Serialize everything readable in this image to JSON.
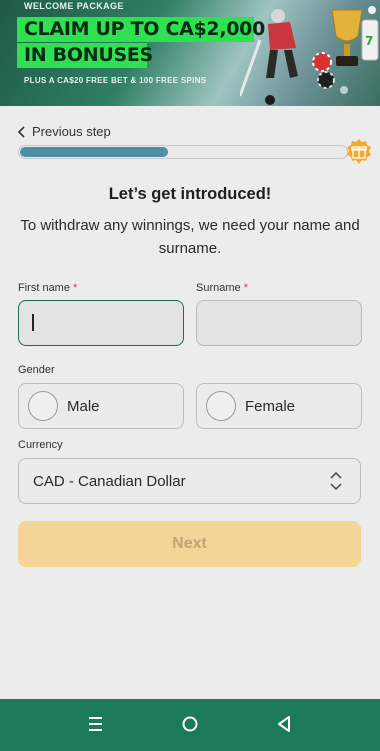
{
  "banner": {
    "kicker": "WELCOME PACKAGE",
    "headline_line1": "CLAIM UP TO CA$2,000",
    "headline_line2": "IN BONUSES",
    "subline": "PLUS A CA$20 FREE BET & 100 FREE SPINS",
    "accent_color": "#2fe050"
  },
  "progress": {
    "back_label": "Previous step",
    "fraction": 0.45,
    "reward_icon": "gift-icon"
  },
  "form": {
    "title": "Let’s get introduced!",
    "subtitle": "To withdraw any winnings, we need your name and surname.",
    "first_name": {
      "label": "First name",
      "required_mark": "*",
      "value": ""
    },
    "surname": {
      "label": "Surname",
      "required_mark": "*",
      "value": ""
    },
    "gender": {
      "label": "Gender",
      "options": [
        "Male",
        "Female"
      ],
      "selected": null
    },
    "currency": {
      "label": "Currency",
      "value": "CAD - Canadian Dollar"
    },
    "next_label": "Next"
  },
  "navbar": {
    "icons": [
      "menu-icon",
      "home-circle-icon",
      "back-triangle-icon"
    ],
    "color": "#1c7a59"
  }
}
